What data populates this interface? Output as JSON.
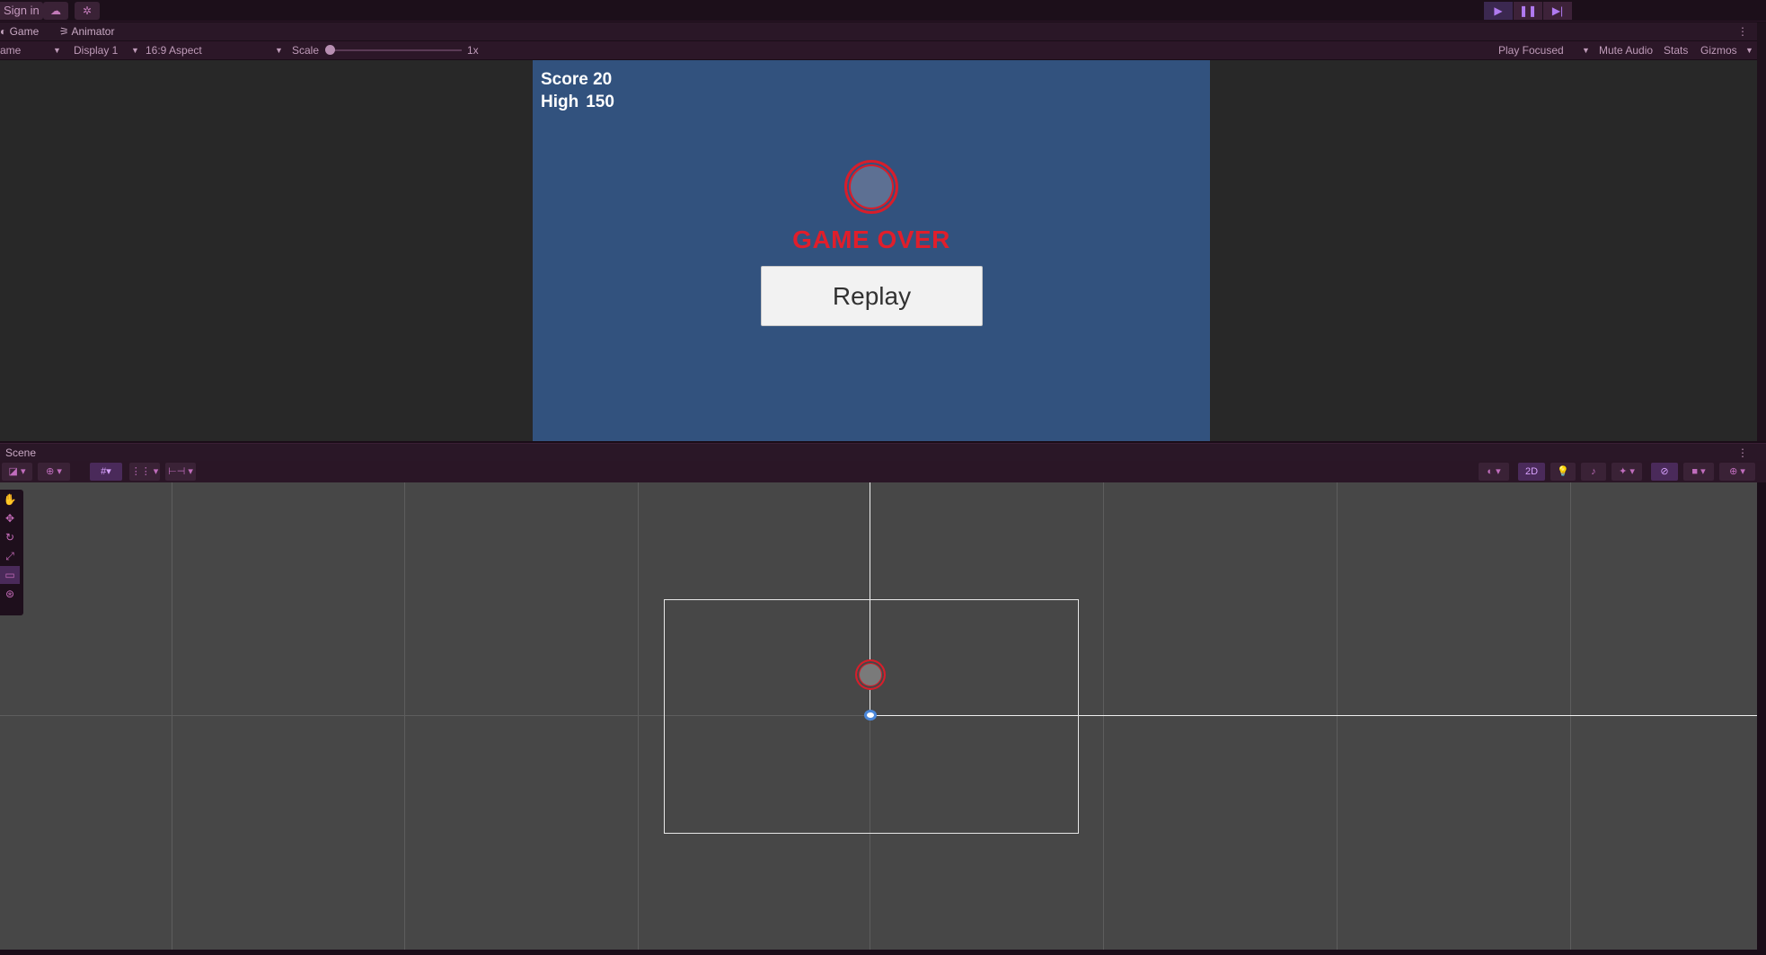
{
  "topbar": {
    "signin_label": "Sign in",
    "cloud_icon": "cloud-icon",
    "services_icon": "services-icon",
    "play_icon": "play-icon",
    "pause_icon": "pause-icon",
    "step_icon": "step-icon"
  },
  "tabs": {
    "game": "Game",
    "animator": "Animator",
    "scene": "Scene"
  },
  "game_toolbar": {
    "mode": "ame",
    "display": "Display 1",
    "aspect": "16:9 Aspect",
    "scale_label": "Scale",
    "scale_value": "1x",
    "play_focused": "Play Focused",
    "mute_audio": "Mute Audio",
    "stats": "Stats",
    "gizmos": "Gizmos"
  },
  "game": {
    "score_label": "Score",
    "score_value": "20",
    "high_label": "High",
    "high_value": "150",
    "game_over": "GAME OVER",
    "replay_label": "Replay"
  },
  "scene_toolbar": {
    "mode_2d": "2D"
  },
  "colors": {
    "editor_bg": "#1a0d18",
    "game_bg": "#32527e",
    "game_over_red": "#e01e2b",
    "scene_bg": "#474747"
  }
}
